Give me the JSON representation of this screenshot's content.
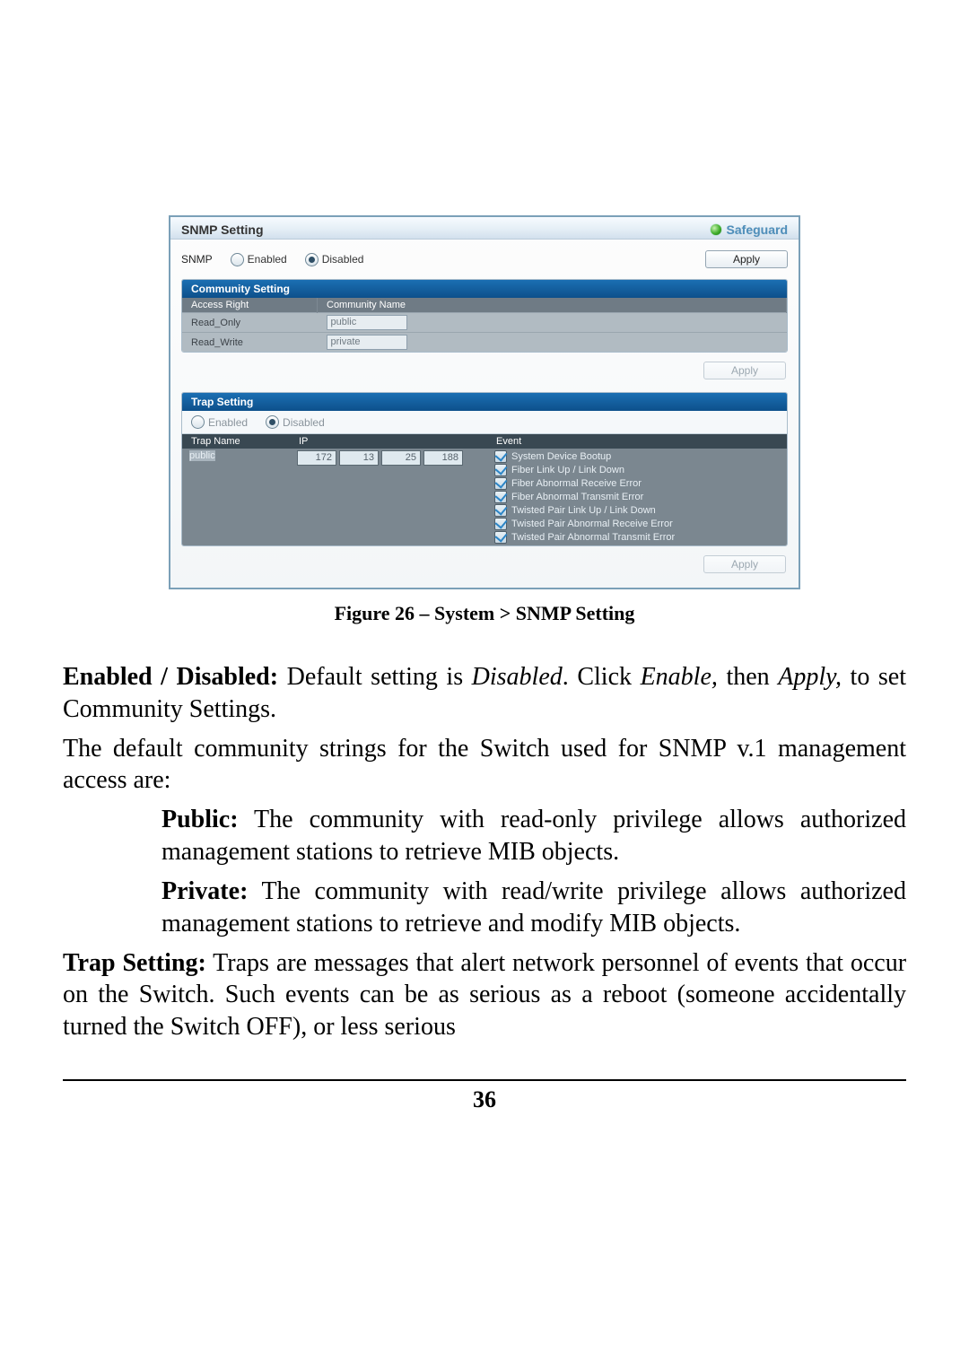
{
  "screenshot": {
    "title": "SNMP Setting",
    "safeguard": "Safeguard",
    "snmp_label": "SNMP",
    "radio_enabled": "Enabled",
    "radio_disabled": "Disabled",
    "apply": "Apply",
    "community_setting": {
      "header": "Community Setting",
      "cols": [
        "Access Right",
        "Community Name"
      ],
      "rows": [
        {
          "right": "Read_Only",
          "name": "public"
        },
        {
          "right": "Read_Write",
          "name": "private"
        }
      ]
    },
    "trap_setting": {
      "header": "Trap Setting",
      "radio_enabled": "Enabled",
      "radio_disabled": "Disabled",
      "cols": [
        "Trap Name",
        "IP",
        "Event"
      ],
      "trap_name": "public",
      "ip": [
        "172",
        "13",
        "25",
        "188"
      ],
      "events": [
        "System Device Bootup",
        "Fiber Link Up / Link Down",
        "Fiber Abnormal Receive Error",
        "Fiber Abnormal Transmit Error",
        "Twisted Pair Link Up / Link Down",
        "Twisted Pair Abnormal Receive Error",
        "Twisted Pair Abnormal Transmit Error"
      ]
    }
  },
  "caption": "Figure 26 – System > SNMP Setting",
  "text": {
    "enabled_label": "Enabled / Disabled:",
    "enabled_body_a": " Default setting is ",
    "enabled_disabled": "Disabled",
    "enabled_body_b": ". Click ",
    "enabled_enable": "Enable,",
    "enabled_body_c": " then ",
    "enabled_apply": "Apply,",
    "enabled_body_d": " to set Community Settings.",
    "default_strings": "The default community strings for the Switch used for SNMP v.1 management access are:",
    "public_label": "Public:",
    "public_body": " The community with read-only privilege allows authorized management stations to retrieve MIB objects.",
    "private_label": "Private:",
    "private_body": " The community with read/write privilege allows authorized management stations to retrieve and modify MIB objects.",
    "trap_label": "Trap Setting:",
    "trap_body": " Traps are messages that alert network personnel of events that occur on the Switch. Such events can be as serious as a reboot (someone accidentally turned the Switch OFF), or less serious"
  },
  "page_number": "36"
}
